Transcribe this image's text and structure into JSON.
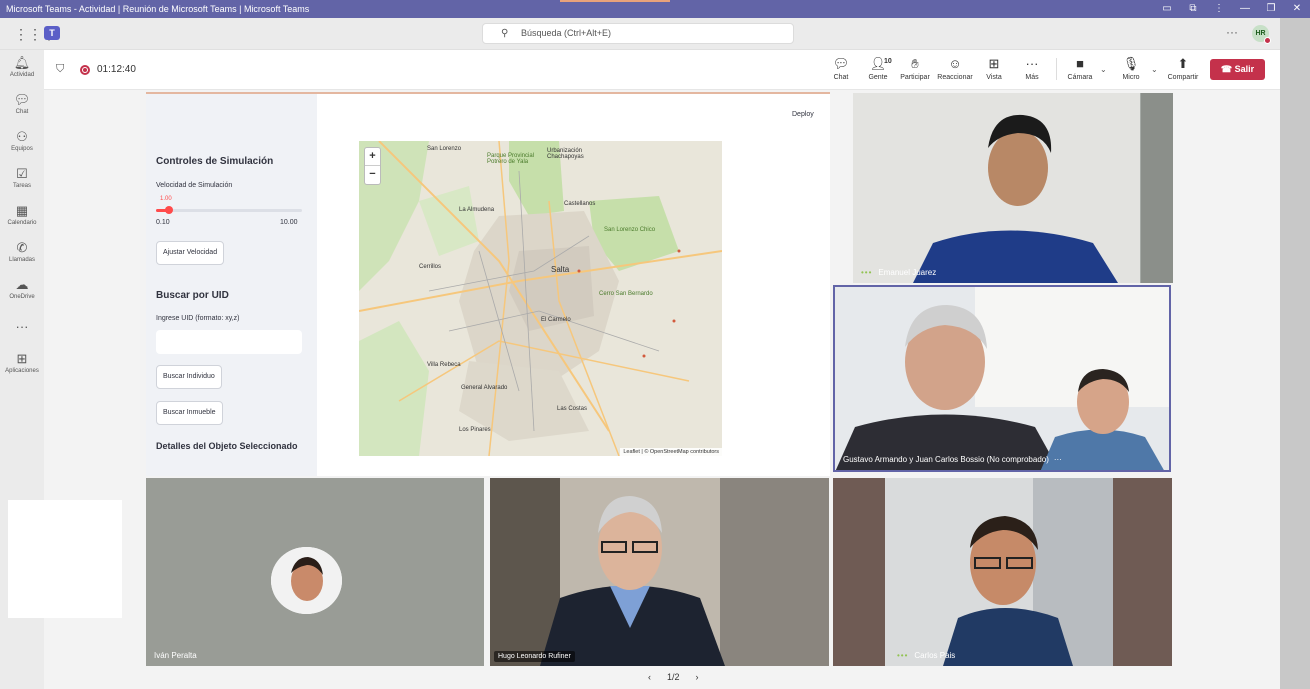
{
  "window": {
    "title": "Microsoft Teams - Actividad | Reunión de Microsoft Teams | Microsoft Teams"
  },
  "topbar": {
    "search_placeholder": "Búsqueda (Ctrl+Alt+E)",
    "user_initials": "HR"
  },
  "rail": {
    "items": [
      {
        "label": "Actividad",
        "icon": "bell-icon"
      },
      {
        "label": "Chat",
        "icon": "chat-icon"
      },
      {
        "label": "Equipos",
        "icon": "teams-icon"
      },
      {
        "label": "Tareas",
        "icon": "tasks-icon"
      },
      {
        "label": "Calendario",
        "icon": "calendar-icon"
      },
      {
        "label": "Llamadas",
        "icon": "phone-icon"
      },
      {
        "label": "OneDrive",
        "icon": "cloud-icon"
      },
      {
        "label": "Aplicaciones",
        "icon": "apps-icon"
      }
    ]
  },
  "meeting": {
    "timer": "01:12:40",
    "people_count": "10",
    "toolbar": {
      "chat": "Chat",
      "people": "Gente",
      "raise": "Participar",
      "react": "Reaccionar",
      "view": "Vista",
      "more": "Más",
      "camera": "Cámara",
      "mic": "Micro",
      "share": "Compartir",
      "leave": "Salir"
    }
  },
  "shared_app": {
    "deploy": "Deploy",
    "controls_title": "Controles de Simulación",
    "speed_label": "Velocidad de Simulación",
    "speed_value": "1.00",
    "speed_min": "0.10",
    "speed_max": "10.00",
    "speed_fraction": 0.09,
    "adjust_button": "Ajustar Velocidad",
    "uid_title": "Buscar por UID",
    "uid_label": "Ingrese UID (formato: xy,z)",
    "search_individual": "Buscar Individuo",
    "search_property": "Buscar Inmueble",
    "details_title": "Detalles del Objeto Seleccionado",
    "map": {
      "zoom_in": "+",
      "zoom_out": "−",
      "attribution": "Leaflet | © OpenStreetMap contributors",
      "places": {
        "p1": "San Lorenzo",
        "p2": "Parque Provincial Potrero de Yala",
        "p3": "Urbanización Chachapoyas",
        "p4": "La Almudena",
        "p5": "Castellanos",
        "p6": "Salta",
        "p7": "Cerrillos",
        "p8": "El Carmelo",
        "p9": "San Lorenzo Chico",
        "p10": "General Alvarado",
        "p11": "Villa Rebeca",
        "p12": "Los Pinares",
        "p13": "Las Costas",
        "p14": "Cerro San Bernardo"
      }
    }
  },
  "participants": [
    {
      "name": "Emanuel Juarez"
    },
    {
      "name": "Gustavo Armando y Juan Carlos Bossio (No comprobado)"
    },
    {
      "name": "Iván Peralta"
    },
    {
      "name": "Hugo Leonardo Rufiner"
    },
    {
      "name": "Carlos Pais"
    }
  ],
  "pager": {
    "label": "1/2"
  }
}
